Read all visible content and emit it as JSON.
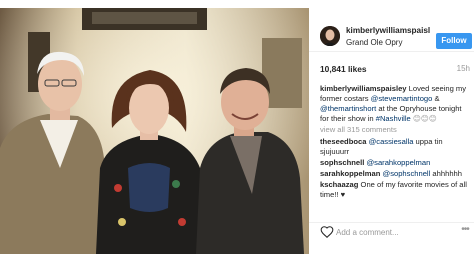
{
  "header": {
    "username": "kimberlywilliamspaisl...",
    "location": "Grand Ole Opry",
    "follow_label": "Follow"
  },
  "meta": {
    "likes": "10,841 likes",
    "time_ago": "15h"
  },
  "caption": {
    "username": "kimberlywilliamspaisley",
    "text_1": " Loved seeing my former costars ",
    "mention_1": "@stevemartintogo",
    "text_2": " & ",
    "mention_2": "@themartinshort",
    "text_3": " at the Opryhouse tonight for their show in ",
    "hashtag": "#Nashville",
    "emoji": "😊😊😊"
  },
  "view_all": "view all 315 comments",
  "comments": [
    {
      "user": "theseedboca",
      "mention": "@cassiesalla",
      "text": " uppa tin sjujuuurr"
    },
    {
      "user": "sophschnell",
      "mention": "@sarahkoppelman",
      "text": ""
    },
    {
      "user": "sarahkoppelman",
      "mention": "@sophschnell",
      "text": " ahhhhhh"
    },
    {
      "user": "kschaazag",
      "mention": "",
      "text": "One of my favorite movies of all time!! ♥"
    }
  ],
  "add_comment_placeholder": "Add a comment...",
  "more_label": "•••",
  "colors": {
    "follow_button": "#3897f0",
    "link": "#003569",
    "muted": "#999999"
  },
  "icons": [
    "heart-icon",
    "more-options-icon"
  ]
}
